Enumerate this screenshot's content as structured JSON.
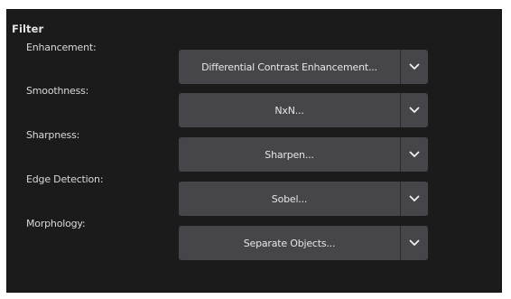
{
  "panel": {
    "title": "Filter"
  },
  "filters": [
    {
      "label": "Enhancement:",
      "value": "Differential Contrast Enhancement..."
    },
    {
      "label": "Smoothness:",
      "value": "NxN..."
    },
    {
      "label": "Sharpness:",
      "value": "Sharpen..."
    },
    {
      "label": "Edge Detection:",
      "value": "Sobel..."
    },
    {
      "label": "Morphology:",
      "value": "Separate Objects..."
    }
  ],
  "icons": {
    "dropdown": "chevron-down-icon"
  },
  "colors": {
    "panel_background": "#1b1b1c",
    "dropdown_background": "#46464a",
    "text": "#e6e6e6"
  }
}
